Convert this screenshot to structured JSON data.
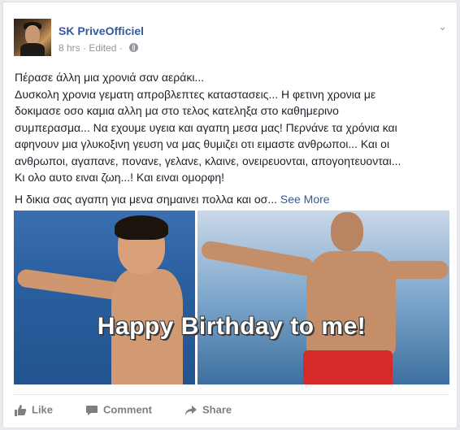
{
  "post": {
    "author": "SK PriveOfficiel",
    "time": "8 hrs",
    "separator": "·",
    "edited": "Edited",
    "separator2": "·",
    "chevron": "⌄",
    "lines": [
      "Πέρασε άλλη μια χρονιά σαν αεράκι...",
      "Δυσκολη χρονια γεματη απροβλεπτες καταστασεις... Η φετινη χρονια με",
      "δοκιμασε οσο καμια αλλη μα στο τελος κατεληξα στο καθημερινο",
      "συμπερασμα... Να εχουμε υγεια και αγαπη μεσα μας! Περνάνε τα χρόνια και",
      "αφηνουν μια γλυκοξινη γευση να μας θυμιζει οτι ειμαστε ανθρωποι... Και οι",
      "ανθρωποι, αγαπανε, πονανε, γελανε, κλαινε, ονειρευονται, απογοητευονται...",
      "Κι ολο αυτο ειναι ζωη...! Και ειναι ομορφη!"
    ],
    "last_line": "Η δικια σας αγαπη για μενα σημαινει πολλα και οσ...",
    "see_more": "See More",
    "image_caption": "Happy Birthday to me!"
  },
  "actions": {
    "like": "Like",
    "comment": "Comment",
    "share": "Share"
  },
  "icons": [
    "globe-icon",
    "chevron-down-icon",
    "like-icon",
    "comment-icon",
    "share-icon"
  ]
}
